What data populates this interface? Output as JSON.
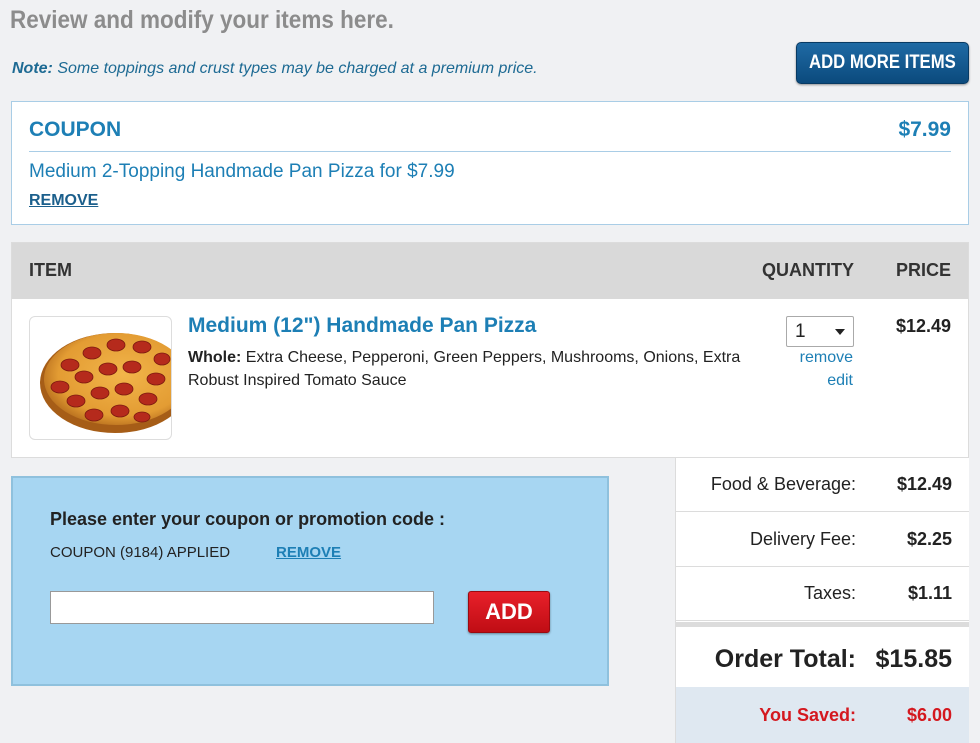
{
  "header": {
    "title": "Review and modify your items here.",
    "note_label": "Note:",
    "note_text": "Some toppings and crust types may be charged at a premium price.",
    "add_more_label": "ADD MORE ITEMS"
  },
  "coupon": {
    "label": "COUPON",
    "amount": "$7.99",
    "description": "Medium 2-Topping Handmade Pan Pizza for $7.99",
    "remove_label": "REMOVE"
  },
  "items_table": {
    "columns": [
      "ITEM",
      "QUANTITY",
      "PRICE"
    ],
    "items": [
      {
        "name": "Medium (12\") Handmade Pan Pizza",
        "desc_label": "Whole:",
        "desc_text": "Extra Cheese, Pepperoni, Green Peppers, Mushrooms, Onions, Extra Robust Inspired Tomato Sauce",
        "quantity": "1",
        "remove_label": "remove",
        "edit_label": "edit",
        "price": "$12.49"
      }
    ]
  },
  "promo": {
    "title": "Please enter your coupon or promotion code :",
    "applied_text": "COUPON (9184) APPLIED",
    "remove_label": "REMOVE",
    "input_value": "",
    "add_label": "ADD"
  },
  "totals": {
    "rows": [
      {
        "label": "Food & Beverage:",
        "value": "$12.49"
      },
      {
        "label": "Delivery Fee:",
        "value": "$2.25"
      },
      {
        "label": "Taxes:",
        "value": "$1.11"
      }
    ],
    "order_total_label": "Order Total:",
    "order_total_value": "$15.85",
    "saved_label": "You Saved:",
    "saved_value": "$6.00"
  },
  "colors": {
    "accent_blue": "#1d7fb5",
    "button_blue": "#0b4a7d",
    "add_red": "#d4181f",
    "promo_bg": "#a7d6f2"
  }
}
